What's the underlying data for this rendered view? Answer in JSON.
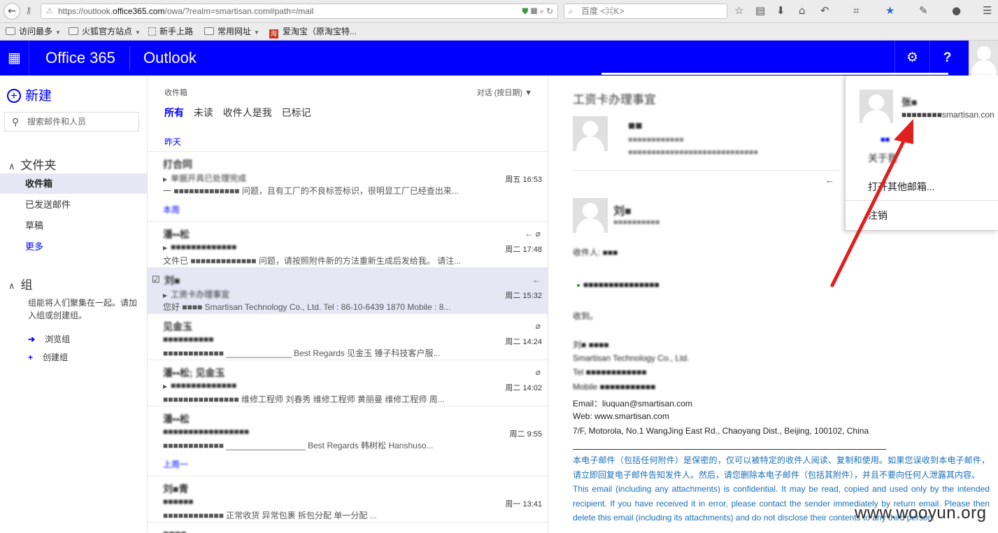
{
  "browser": {
    "url_prefix": "https://outlook.",
    "url_domain": "office365.com",
    "url_suffix": "/owa/?realm=smartisan.com#path=/mail",
    "search_placeholder": "百度 <⌘K>",
    "bookmarks": [
      "访问最多",
      "火狐官方站点",
      "新手上路",
      "常用网址",
      "爱淘宝（原淘宝特..."
    ]
  },
  "o365": {
    "brand": "Office 365",
    "app": "Outlook",
    "settings_glyph": "⚙",
    "help_glyph": "?",
    "waffle_glyph": "▦"
  },
  "leftnav": {
    "new_label": "新建",
    "search_placeholder": "搜索邮件和人员",
    "folders_header": "文件夹",
    "folders": [
      "收件箱",
      "已发送邮件",
      "草稿",
      "更多"
    ],
    "groups_header": "组",
    "groups_desc": "组能将人们聚集在一起。请加入组或创建组。",
    "browse_groups": "浏览组",
    "create_group": "创建组"
  },
  "maillist": {
    "folder": "收件箱",
    "sort": "对话 (按日期)",
    "filters": [
      "所有",
      "未读",
      "收件人是我",
      "已标记"
    ],
    "group_yesterday": "昨天",
    "group_this_week": "本周",
    "group_last_week": "上周一",
    "messages": [
      {
        "sender": "打合同",
        "subject": "单据开具已处理完成",
        "preview": "一 ■■■■■■■■■■■■■ 问题，且有工厂的不良标签标识，很明显工厂已经查出来...",
        "time": "周五 16:53"
      },
      {
        "sender": "潘▪▪松",
        "subject": "■■■■■■■■■■■■■",
        "preview": "文件已 ■■■■■■■■■■■■■ 问题，请按照附件新的方法重新生成后发给我。 请注...",
        "time": "周二 17:48"
      },
      {
        "sender": "刘■",
        "subject": "工资卡办理事宜",
        "preview": "您好 ■■■■ Smartisan Technology Co., Ltd. Tel : 86-10-6439 1870 Mobile : 8...",
        "time": "周二 15:32"
      },
      {
        "sender": "见金玉",
        "subject": "■■■■■■■■■■",
        "preview": "■■■■■■■■■■■■ ______________ Best Regards 见金玉 锤子科技客户服...",
        "time": "周二 14:24"
      },
      {
        "sender": "潘▪▪松; 见金玉",
        "subject": "■■■■■■■■■■■■■",
        "preview": "■■■■■■■■■■■■■■■ 维修工程师 刘春秀 维修工程师 黄丽曼 维修工程师 周...",
        "time": "周二 14:02"
      },
      {
        "sender": "潘▪▪松",
        "subject": "■■■■■■■■■■■■■■■■■",
        "preview": "■■■■■■■■■■■■ _________________ Best Regards 韩树松 Hanshuso...",
        "time": "周二 9:55"
      },
      {
        "sender": "刘■青",
        "subject": "■■■■■■",
        "preview": "■■■■■■■■■■■■ 正常收货        异常包裹        拆包分配 单一分配      ...",
        "time": "周一 13:41"
      },
      {
        "sender": "■■■■",
        "subject": "",
        "preview": "",
        "time": ""
      }
    ]
  },
  "reading": {
    "subject": "工资卡办理事宜",
    "reply_sender": "■■",
    "reply_meta1": "■■■■■■■■■■■■",
    "reply_meta2": "■■■■■■■■■■■■■■■■■■■■■■■■■■■■",
    "sender": "刘■",
    "sender_meta": "■■■■■■■■■■",
    "to_line": "收件人: ■■■",
    "date_line": "■■■■■■■■■■■■■■■",
    "greeting": "收到。",
    "sig_name": "刘■ ■■■■",
    "sig_company": "Smartisan Technology Co., Ltd.",
    "sig_tel": "Tel ■■■■■■■■■■■■",
    "sig_mobile": "Mobile ■■■■■■■■■■■",
    "sig_email": "Email：liuquan@smartisan.com",
    "sig_web": "Web: www.smartisan.com",
    "sig_addr": "7/F, Motorola, No.1 WangJing East Rd., Chaoyang Dist., Beijing, 100102, China",
    "disclaimer_cn": "本电子邮件（包括任何附件）是保密的，仅可以被特定的收件人阅读、复制和使用。如果您误收到本电子邮件，请立即回复电子邮件告知发件人。然后，请您删除本电子邮件（包括其附件），并且不要向任何人泄露其内容。",
    "disclaimer_en": "This email (including any attachments) is confidential. It may be read, copied and used only by the intended recipient. If you have received it in error, please contact the sender immediately by return email. Please then delete this email (including its attachments) and do not disclose their contents to any third person."
  },
  "popup": {
    "name": "张■",
    "email": "■■■■■■■■smartisan.con",
    "small_link": "■■",
    "about": "关于我",
    "open_other": "打开其他邮箱...",
    "signout": "注销"
  },
  "watermark": "www.wooyun.org"
}
